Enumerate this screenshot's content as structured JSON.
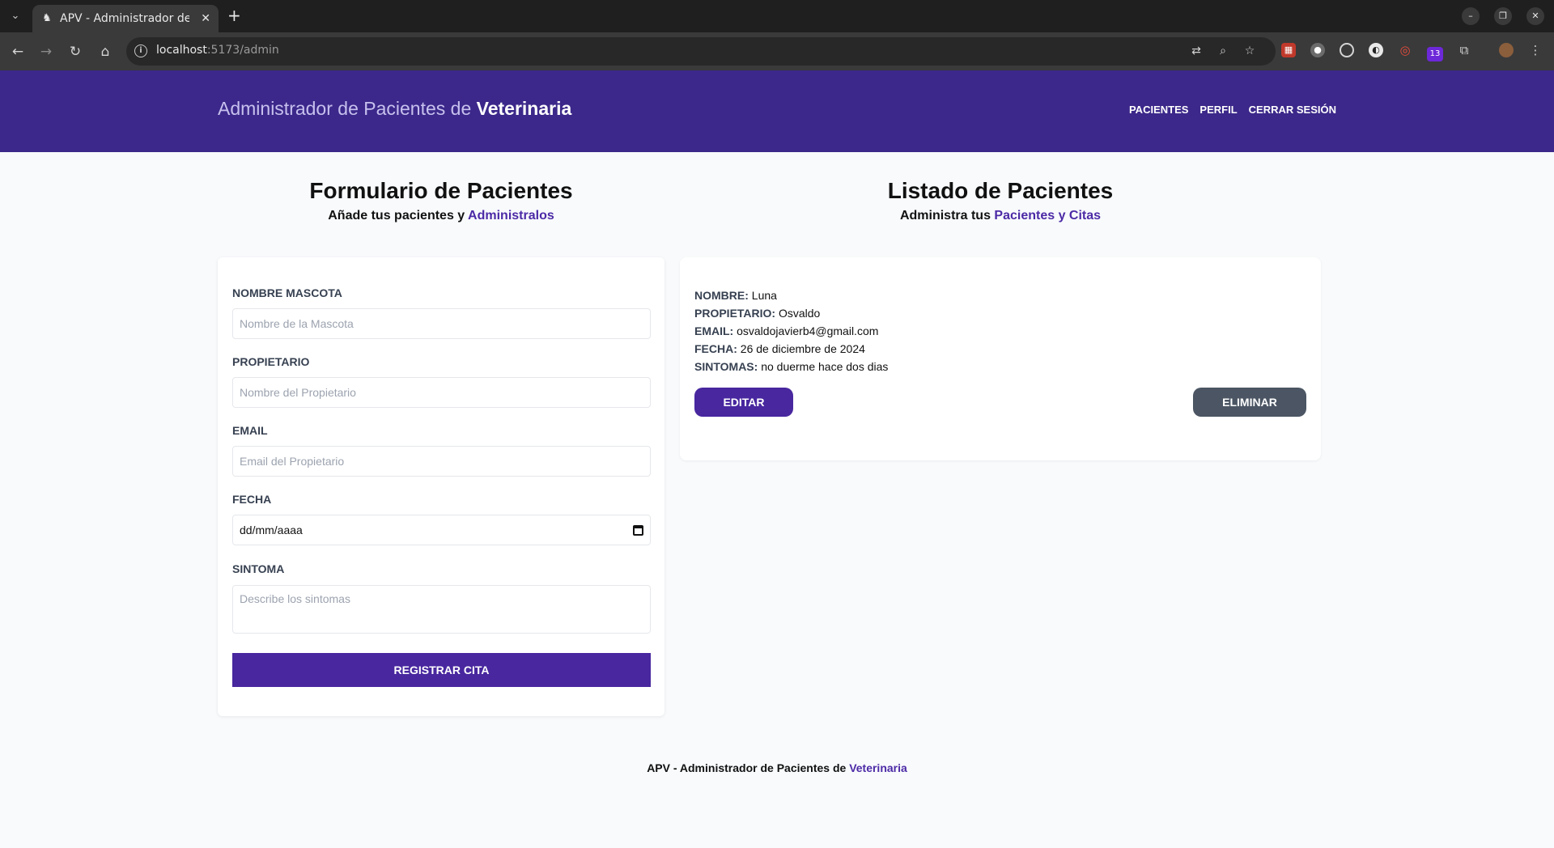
{
  "browser": {
    "tab_title": "APV - Administrador de Pacientes",
    "url_host": "localhost",
    "url_rest": ":5173/admin",
    "extension_badge": "13"
  },
  "header": {
    "brand_prefix": "Administrador de Pacientes de ",
    "brand_strong": "Veterinaria",
    "nav": [
      "Pacientes",
      "Perfil",
      "Cerrar Sesión"
    ]
  },
  "form_section": {
    "title": "Formulario de Pacientes",
    "subtitle_prefix": "Añade tus pacientes y ",
    "subtitle_accent": "Administralos",
    "fields": {
      "pet_label": "Nombre Mascota",
      "pet_placeholder": "Nombre de la Mascota",
      "owner_label": "Propietario",
      "owner_placeholder": "Nombre del Propietario",
      "email_label": "Email",
      "email_placeholder": "Email del Propietario",
      "date_label": "Fecha",
      "date_value": "dd/mm/aaaa",
      "symptom_label": "Sintoma",
      "symptom_placeholder": "Describe los sintomas"
    },
    "submit_label": "Registrar Cita"
  },
  "list_section": {
    "title": "Listado de Pacientes",
    "subtitle_prefix": "Administra tus ",
    "subtitle_accent": "Pacientes y Citas",
    "patient": {
      "name_label": "NOMBRE:",
      "name": "Luna",
      "owner_label": "PROPIETARIO:",
      "owner": "Osvaldo",
      "email_label": "EMAIL:",
      "email": "osvaldojavierb4@gmail.com",
      "date_label": "FECHA:",
      "date": "26 de diciembre de 2024",
      "symptoms_label": "SINTOMAS:",
      "symptoms": "no duerme hace dos dias"
    },
    "edit_label": "EDITAR",
    "delete_label": "ELIMINAR"
  },
  "footer": {
    "text_prefix": "APV - Administrador de Pacientes de ",
    "text_accent": "Veterinaria"
  },
  "colors": {
    "header_bg": "#3c288a",
    "accent": "#4c2aa6",
    "primary_button": "#48279f",
    "delete_button": "#4b5563"
  }
}
